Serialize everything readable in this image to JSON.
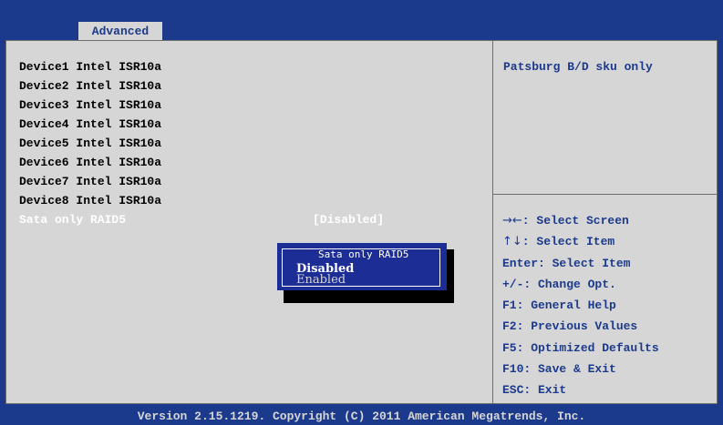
{
  "tab": {
    "label": "Advanced"
  },
  "items": [
    "Device1 Intel ISR10a",
    "Device2 Intel ISR10a",
    "Device3 Intel ISR10a",
    "Device4 Intel ISR10a",
    "Device5 Intel ISR10a",
    "Device6 Intel ISR10a",
    "Device7 Intel ISR10a",
    "Device8 Intel ISR10a"
  ],
  "selected": {
    "label": "Sata only RAID5",
    "value": "[Disabled]"
  },
  "help": {
    "text": "Patsburg B/D sku only"
  },
  "keys": [
    {
      "icon": "→←",
      "text": ": Select Screen"
    },
    {
      "icon": "↑↓",
      "text": ": Select Item"
    },
    {
      "icon": "",
      "text": "Enter: Select Item"
    },
    {
      "icon": "",
      "text": "+/-: Change Opt."
    },
    {
      "icon": "",
      "text": "F1: General Help"
    },
    {
      "icon": "",
      "text": "F2: Previous Values"
    },
    {
      "icon": "",
      "text": "F5: Optimized Defaults"
    },
    {
      "icon": "",
      "text": "F10: Save & Exit"
    },
    {
      "icon": "",
      "text": "ESC: Exit"
    }
  ],
  "popup": {
    "title": "Sata only RAID5",
    "options": [
      "Disabled",
      "Enabled"
    ]
  },
  "footer": "Version 2.15.1219. Copyright (C) 2011 American Megatrends, Inc.",
  "colors": {
    "background": "#1c3a8c",
    "panel": "#d6d6d6",
    "popup": "#1c2e96"
  }
}
